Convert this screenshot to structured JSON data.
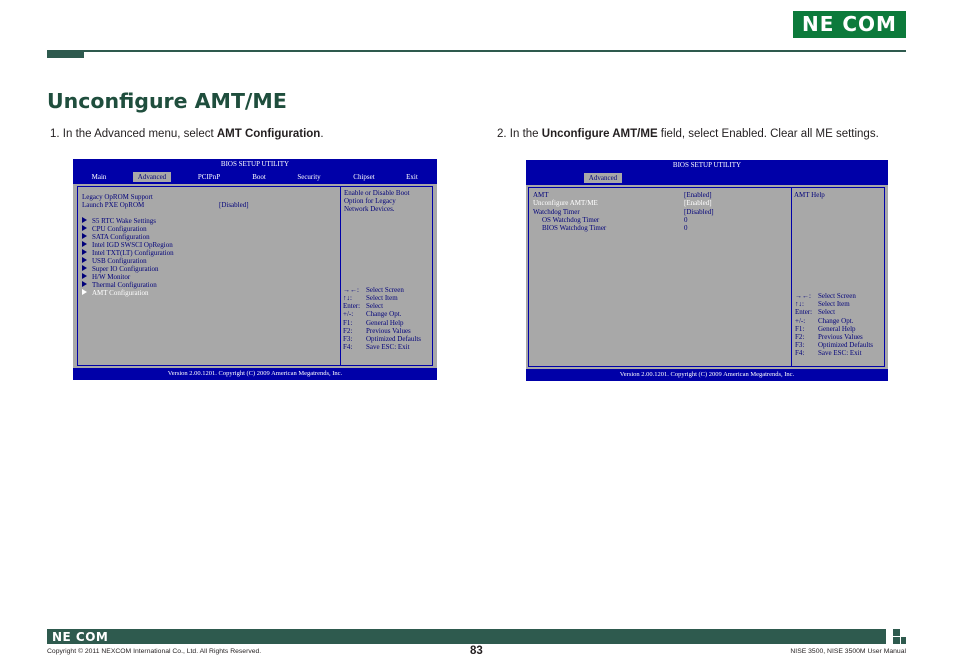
{
  "header": {
    "logo": "NE COM",
    "title": "Unconfigure AMT/ME"
  },
  "steps": [
    {
      "prefix": "1.  In the Advanced menu, select ",
      "bold": "AMT Configuration",
      "suffix": "."
    },
    {
      "prefix": "2.  In the ",
      "bold": "Unconfigure AMT/ME",
      "suffix": " field, select Enabled. Clear all ME settings."
    }
  ],
  "bios1": {
    "title": "BIOS SETUP UTILITY",
    "menu": [
      "Main",
      "Advanced",
      "PCIPnP",
      "Boot",
      "Security",
      "Chipset",
      "Exit"
    ],
    "active_menu": "Advanced",
    "rows": [
      {
        "label": "Legacy OpROM Support",
        "value": ""
      },
      {
        "label": "Launch PXE OpROM",
        "value": "[Disabled]"
      }
    ],
    "submenus": [
      "S5 RTC Wake Settings",
      "CPU Configuration",
      "SATA Configuration",
      "Intel IGD SWSCI OpRegion",
      "Intel TXT(LT) Configuration",
      "USB Configuration",
      "Super IO Configuration",
      "H/W Monitor",
      "Thermal Configuration",
      "AMT Configuration"
    ],
    "highlighted_submenu": "AMT Configuration",
    "help": [
      "Enable or Disable Boot",
      "Option for Legacy",
      "Network Devices."
    ],
    "keys": [
      {
        "key": "→←:",
        "action": "Select Screen"
      },
      {
        "key": "↑↓:",
        "action": "Select Item"
      },
      {
        "key": "Enter:",
        "action": "Select"
      },
      {
        "key": "+/-:",
        "action": "Change Opt."
      },
      {
        "key": "F1:",
        "action": "General Help"
      },
      {
        "key": "F2:",
        "action": "Previous Values"
      },
      {
        "key": "F3:",
        "action": "Optimized Defaults"
      },
      {
        "key": "F4:",
        "action": "Save   ESC:  Exit"
      }
    ],
    "footer": "Version 2.00.1201. Copyright (C) 2009 American Megatrends, Inc."
  },
  "bios2": {
    "title": "BIOS SETUP UTILITY",
    "active_menu": "Advanced",
    "rows": [
      {
        "label": "AMT",
        "value": "[Enabled]",
        "highlight": false
      },
      {
        "label": "Unconfigure AMT/ME",
        "value": "[Enabled]",
        "highlight": true
      },
      {
        "label": "Watchdog Timer",
        "value": "[Disabled]",
        "highlight": false
      },
      {
        "label": "OS Watchdog Timer",
        "value": "0",
        "highlight": false
      },
      {
        "label": "BIOS Watchdog Timer",
        "value": "0",
        "highlight": false
      }
    ],
    "help": [
      "AMT Help"
    ],
    "keys": [
      {
        "key": "→←:",
        "action": "Select Screen"
      },
      {
        "key": "↑↓:",
        "action": "Select Item"
      },
      {
        "key": "Enter:",
        "action": "Select"
      },
      {
        "key": "+/-:",
        "action": "Change Opt."
      },
      {
        "key": "F1:",
        "action": "General Help"
      },
      {
        "key": "F2:",
        "action": "Previous Values"
      },
      {
        "key": "F3:",
        "action": "Optimized Defaults"
      },
      {
        "key": "F4:",
        "action": "Save   ESC:  Exit"
      }
    ],
    "footer": "Version 2.00.1201. Copyright (C) 2009 American Megatrends, Inc."
  },
  "footer": {
    "logo": "NE COM",
    "copyright": "Copyright © 2011 NEXCOM International Co., Ltd. All Rights Reserved.",
    "page_number": "83",
    "manual": "NISE 3500, NISE 3500M User Manual"
  },
  "colors": {
    "brand_green": "#0c7a3b",
    "rule_green": "#2e5a4e",
    "bios_blue": "#0000a8",
    "bios_gray": "#a8a8a8"
  }
}
